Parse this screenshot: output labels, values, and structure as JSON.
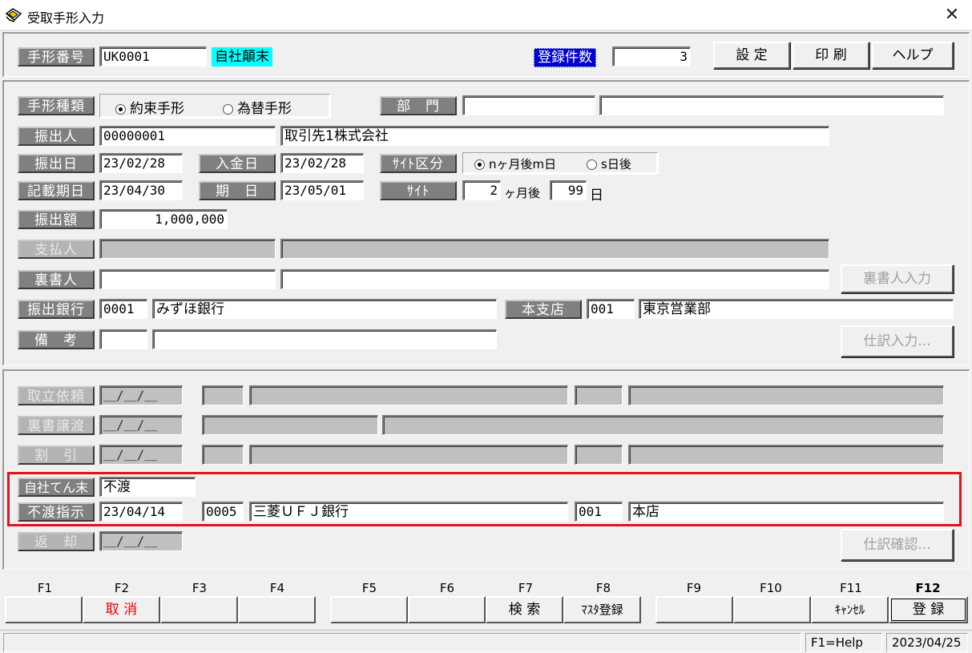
{
  "window": {
    "title": "受取手形入力",
    "close_glyph": "✕"
  },
  "header": {
    "bill_no_label": "手形番号",
    "bill_no_value": "UK0001",
    "status_tag": "自社顛末",
    "count_label": "登録件数",
    "count_value": "3",
    "settings_label": "設 定",
    "print_label": "印 刷",
    "help_label": "ヘルプ"
  },
  "main": {
    "bill_type_label": "手形種類",
    "bill_type_options": [
      "約束手形",
      "為替手形"
    ],
    "bill_type_selected": 0,
    "dept_label": "部　門",
    "dept_code": "",
    "dept_name": "",
    "drawer_label": "振出人",
    "drawer_code": "00000001",
    "drawer_name": "取引先1株式会社",
    "issue_date_label": "振出日",
    "issue_date": "23/02/28",
    "receipt_date_label": "入金日",
    "receipt_date": "23/02/28",
    "site_type_label": "ｻｲﾄ区分",
    "site_type_options": [
      "nヶ月後m日",
      "s日後"
    ],
    "site_type_selected": 0,
    "entry_date_label": "記載期日",
    "entry_date": "23/04/30",
    "due_label": "期　日",
    "due_date": "23/05/01",
    "site_label": "ｻｲﾄ",
    "site_months": "2",
    "site_months_unit": "ヶ月後",
    "site_days": "99",
    "site_days_unit": "日",
    "amount_label": "振出額",
    "amount": "1,000,000",
    "payer_label": "支払人",
    "endorser_label": "裏書人",
    "endorser_btn": "裏書人入力",
    "bank_label": "振出銀行",
    "bank_code": "0001",
    "bank_name": "みずほ銀行",
    "branch_label": "本支店",
    "branch_code": "001",
    "branch_name": "東京営業部",
    "memo_label": "備　考",
    "journal_btn": "仕訳入力..."
  },
  "lower": {
    "collect_label": "取立依頼",
    "transfer_label": "裏書譲渡",
    "discount_label": "割　引",
    "empty_date": "＿/＿/＿",
    "own_result_label": "自社てん末",
    "own_result_value": "不渡",
    "dishonor_label": "不渡指示",
    "dishonor_date": "23/04/14",
    "dishonor_bank_code": "0005",
    "dishonor_bank_name": "三菱ＵＦＪ銀行",
    "dishonor_branch_code": "001",
    "dishonor_branch_name": "本店",
    "return_label": "返　却",
    "journal_check_btn": "仕訳確認..."
  },
  "fkeys": {
    "labels": [
      "F1",
      "F2",
      "F3",
      "F4",
      "F5",
      "F6",
      "F7",
      "F8",
      "F9",
      "F10",
      "F11",
      "F12"
    ],
    "buttons": [
      "",
      "取 消",
      "",
      "",
      "",
      "",
      "検 索",
      "ﾏｽﾀ登録",
      "",
      "",
      "ｷｬﾝｾﾙ",
      "登 録"
    ]
  },
  "status": {
    "help": "F1=Help",
    "date": "2023/04/25"
  },
  "colors": {
    "highlight": "#e0151b",
    "tag_cyan": "#00ffff",
    "tag_blue": "#0000d0",
    "label_gray": "#808080"
  }
}
